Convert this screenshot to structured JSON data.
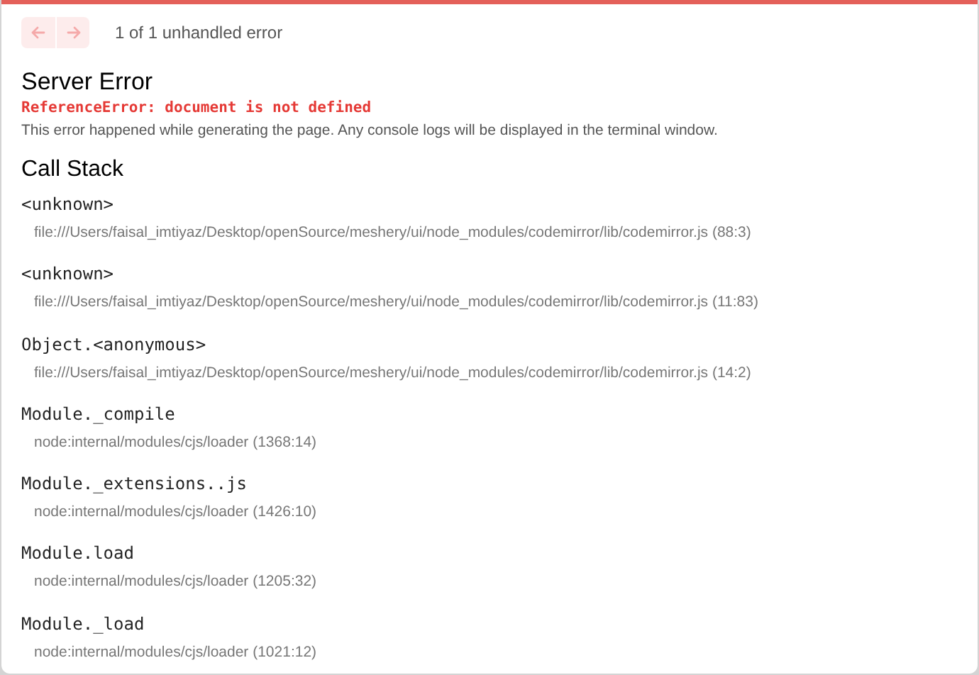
{
  "nav": {
    "prev_disabled": true,
    "next_disabled": true,
    "counter": "1 of 1 unhandled error"
  },
  "title": "Server Error",
  "error_message": "ReferenceError: document is not defined",
  "description": "This error happened while generating the page. Any console logs will be displayed in the terminal window.",
  "call_stack": {
    "heading": "Call Stack",
    "frames": [
      {
        "function": "<unknown>",
        "location": "file:///Users/faisal_imtiyaz/Desktop/openSource/meshery/ui/node_modules/codemirror/lib/codemirror.js (88:3)"
      },
      {
        "function": "<unknown>",
        "location": "file:///Users/faisal_imtiyaz/Desktop/openSource/meshery/ui/node_modules/codemirror/lib/codemirror.js (11:83)"
      },
      {
        "function": "Object.<anonymous>",
        "location": "file:///Users/faisal_imtiyaz/Desktop/openSource/meshery/ui/node_modules/codemirror/lib/codemirror.js (14:2)"
      },
      {
        "function": "Module._compile",
        "location": "node:internal/modules/cjs/loader (1368:14)"
      },
      {
        "function": "Module._extensions..js",
        "location": "node:internal/modules/cjs/loader (1426:10)"
      },
      {
        "function": "Module.load",
        "location": "node:internal/modules/cjs/loader (1205:32)"
      },
      {
        "function": "Module._load",
        "location": "node:internal/modules/cjs/loader (1021:12)"
      }
    ]
  }
}
